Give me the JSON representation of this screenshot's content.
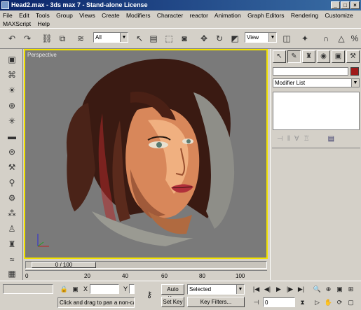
{
  "window": {
    "title": "Head2.max - 3ds max 7 - Stand-alone License",
    "controls": [
      "_",
      "□",
      "×"
    ]
  },
  "menu": [
    "File",
    "Edit",
    "Tools",
    "Group",
    "Views",
    "Create",
    "Modifiers",
    "Character",
    "reactor",
    "Animation",
    "Graph Editors",
    "Rendering",
    "Customize",
    "MAXScript",
    "Help"
  ],
  "toolbar": {
    "selection_filter": "All",
    "ref_coord": "View"
  },
  "viewport": {
    "label": "Perspective"
  },
  "command_panel": {
    "modifier_list": "Modifier List"
  },
  "timeline": {
    "slider_label": "0 / 100",
    "ticks": [
      "0",
      "20",
      "40",
      "60",
      "80",
      "100"
    ]
  },
  "status": {
    "x_label": "X",
    "y_label": "Y",
    "prompt": "Click and drag to pan a non-cam",
    "auto_key": "Auto Key",
    "set_key": "Set Key",
    "selected": "Selected",
    "key_filters": "Key Filters...",
    "frame": "0"
  }
}
